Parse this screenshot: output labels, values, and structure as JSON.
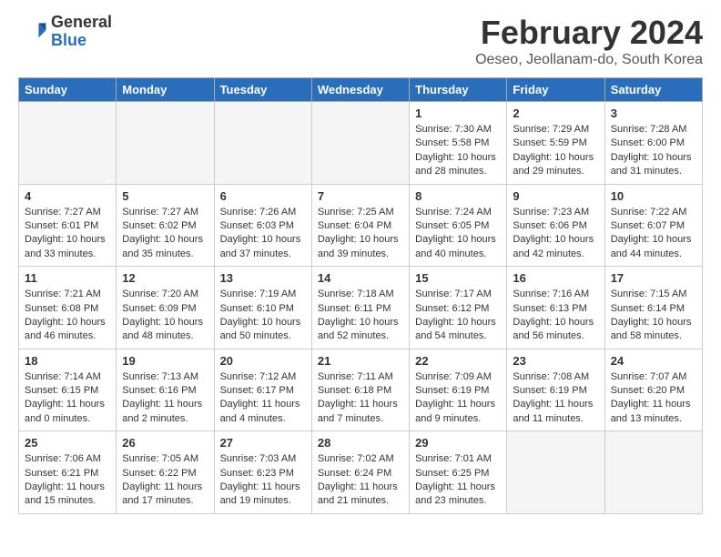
{
  "header": {
    "logo_general": "General",
    "logo_blue": "Blue",
    "month_title": "February 2024",
    "location": "Oeseo, Jeollanam-do, South Korea"
  },
  "days_of_week": [
    "Sunday",
    "Monday",
    "Tuesday",
    "Wednesday",
    "Thursday",
    "Friday",
    "Saturday"
  ],
  "weeks": [
    [
      {
        "num": "",
        "info": ""
      },
      {
        "num": "",
        "info": ""
      },
      {
        "num": "",
        "info": ""
      },
      {
        "num": "",
        "info": ""
      },
      {
        "num": "1",
        "info": "Sunrise: 7:30 AM\nSunset: 5:58 PM\nDaylight: 10 hours\nand 28 minutes."
      },
      {
        "num": "2",
        "info": "Sunrise: 7:29 AM\nSunset: 5:59 PM\nDaylight: 10 hours\nand 29 minutes."
      },
      {
        "num": "3",
        "info": "Sunrise: 7:28 AM\nSunset: 6:00 PM\nDaylight: 10 hours\nand 31 minutes."
      }
    ],
    [
      {
        "num": "4",
        "info": "Sunrise: 7:27 AM\nSunset: 6:01 PM\nDaylight: 10 hours\nand 33 minutes."
      },
      {
        "num": "5",
        "info": "Sunrise: 7:27 AM\nSunset: 6:02 PM\nDaylight: 10 hours\nand 35 minutes."
      },
      {
        "num": "6",
        "info": "Sunrise: 7:26 AM\nSunset: 6:03 PM\nDaylight: 10 hours\nand 37 minutes."
      },
      {
        "num": "7",
        "info": "Sunrise: 7:25 AM\nSunset: 6:04 PM\nDaylight: 10 hours\nand 39 minutes."
      },
      {
        "num": "8",
        "info": "Sunrise: 7:24 AM\nSunset: 6:05 PM\nDaylight: 10 hours\nand 40 minutes."
      },
      {
        "num": "9",
        "info": "Sunrise: 7:23 AM\nSunset: 6:06 PM\nDaylight: 10 hours\nand 42 minutes."
      },
      {
        "num": "10",
        "info": "Sunrise: 7:22 AM\nSunset: 6:07 PM\nDaylight: 10 hours\nand 44 minutes."
      }
    ],
    [
      {
        "num": "11",
        "info": "Sunrise: 7:21 AM\nSunset: 6:08 PM\nDaylight: 10 hours\nand 46 minutes."
      },
      {
        "num": "12",
        "info": "Sunrise: 7:20 AM\nSunset: 6:09 PM\nDaylight: 10 hours\nand 48 minutes."
      },
      {
        "num": "13",
        "info": "Sunrise: 7:19 AM\nSunset: 6:10 PM\nDaylight: 10 hours\nand 50 minutes."
      },
      {
        "num": "14",
        "info": "Sunrise: 7:18 AM\nSunset: 6:11 PM\nDaylight: 10 hours\nand 52 minutes."
      },
      {
        "num": "15",
        "info": "Sunrise: 7:17 AM\nSunset: 6:12 PM\nDaylight: 10 hours\nand 54 minutes."
      },
      {
        "num": "16",
        "info": "Sunrise: 7:16 AM\nSunset: 6:13 PM\nDaylight: 10 hours\nand 56 minutes."
      },
      {
        "num": "17",
        "info": "Sunrise: 7:15 AM\nSunset: 6:14 PM\nDaylight: 10 hours\nand 58 minutes."
      }
    ],
    [
      {
        "num": "18",
        "info": "Sunrise: 7:14 AM\nSunset: 6:15 PM\nDaylight: 11 hours\nand 0 minutes."
      },
      {
        "num": "19",
        "info": "Sunrise: 7:13 AM\nSunset: 6:16 PM\nDaylight: 11 hours\nand 2 minutes."
      },
      {
        "num": "20",
        "info": "Sunrise: 7:12 AM\nSunset: 6:17 PM\nDaylight: 11 hours\nand 4 minutes."
      },
      {
        "num": "21",
        "info": "Sunrise: 7:11 AM\nSunset: 6:18 PM\nDaylight: 11 hours\nand 7 minutes."
      },
      {
        "num": "22",
        "info": "Sunrise: 7:09 AM\nSunset: 6:19 PM\nDaylight: 11 hours\nand 9 minutes."
      },
      {
        "num": "23",
        "info": "Sunrise: 7:08 AM\nSunset: 6:19 PM\nDaylight: 11 hours\nand 11 minutes."
      },
      {
        "num": "24",
        "info": "Sunrise: 7:07 AM\nSunset: 6:20 PM\nDaylight: 11 hours\nand 13 minutes."
      }
    ],
    [
      {
        "num": "25",
        "info": "Sunrise: 7:06 AM\nSunset: 6:21 PM\nDaylight: 11 hours\nand 15 minutes."
      },
      {
        "num": "26",
        "info": "Sunrise: 7:05 AM\nSunset: 6:22 PM\nDaylight: 11 hours\nand 17 minutes."
      },
      {
        "num": "27",
        "info": "Sunrise: 7:03 AM\nSunset: 6:23 PM\nDaylight: 11 hours\nand 19 minutes."
      },
      {
        "num": "28",
        "info": "Sunrise: 7:02 AM\nSunset: 6:24 PM\nDaylight: 11 hours\nand 21 minutes."
      },
      {
        "num": "29",
        "info": "Sunrise: 7:01 AM\nSunset: 6:25 PM\nDaylight: 11 hours\nand 23 minutes."
      },
      {
        "num": "",
        "info": ""
      },
      {
        "num": "",
        "info": ""
      }
    ]
  ]
}
